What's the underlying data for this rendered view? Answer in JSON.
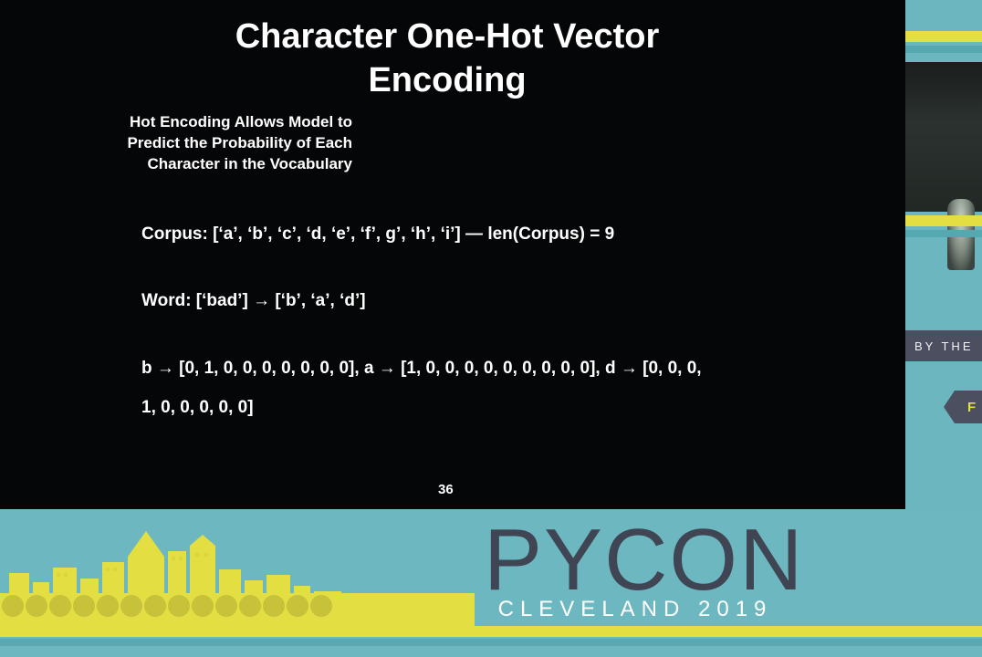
{
  "slide": {
    "title_line1": "Character One-Hot Vector",
    "title_line2": "Encoding",
    "subtitle_line1": "Hot Encoding Allows Model to",
    "subtitle_line2": "Predict the Probability of Each",
    "subtitle_line3": "Character in the Vocabulary",
    "corpus_text": "Corpus: [‘a’, ‘b’, ‘c’, ‘d, ‘e’, ‘f’, g’, ‘h’, ‘i’] — len(Corpus) = 9",
    "word_text": "Word: [‘bad’] → [‘b’, ‘a’, ‘d’]",
    "encoding_line1": "b → [0, 1, 0, 0, 0, 0, 0, 0, 0], a → [1, 0, 0, 0, 0, 0, 0, 0, 0, 0], d → [0, 0, 0,",
    "encoding_line2": "1, 0, 0, 0, 0, 0]",
    "page_number": "36"
  },
  "banner": {
    "conference_name": "PYCON",
    "location_year": "CLEVELAND 2019",
    "side_banner_text": "BY THE",
    "side_banner_letter": "F"
  },
  "colors": {
    "slide_background": "#050608",
    "banner_teal": "#6db8c0",
    "banner_yellow": "#e3df43",
    "banner_dark": "#3f4553"
  }
}
